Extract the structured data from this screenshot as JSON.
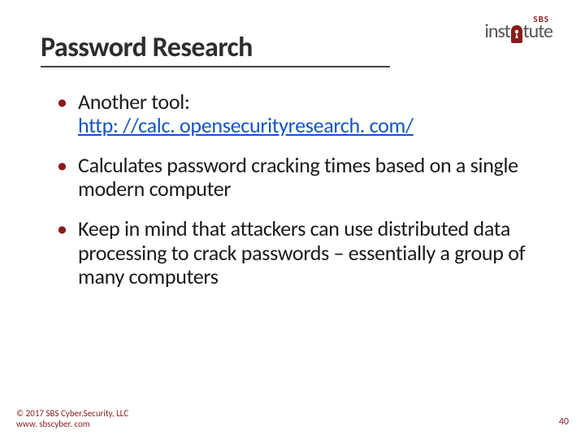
{
  "logo": {
    "top": "SBS",
    "line_pre": "inst",
    "line_post": "tute"
  },
  "title": "Password Research",
  "bullets": [
    {
      "pre": "Another tool: ",
      "link_text": "http: //calc. opensecurityresearch. com/",
      "post": ""
    },
    {
      "pre": "Calculates password cracking times based on a single modern computer",
      "link_text": "",
      "post": ""
    },
    {
      "pre": "Keep in mind that attackers can use distributed data processing to crack passwords – essentially a group of many computers",
      "link_text": "",
      "post": ""
    }
  ],
  "footer": {
    "copyright": "© 2017 SBS Cyber.Security, LLC",
    "url": "www. sbscyber. com"
  },
  "page_number": "40"
}
